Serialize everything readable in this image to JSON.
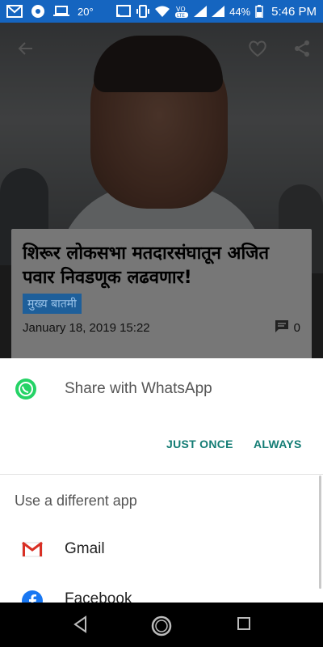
{
  "status_bar": {
    "temperature": "20°",
    "battery": "44%",
    "time": "5:46 PM",
    "network_badge": "VO LTE",
    "background_color": "#1565c0"
  },
  "article": {
    "headline": "शिरूर लोकसभा मतदारसंघातून अजित पवार निवडणूक लढवणार!",
    "category": "मुख्य बातमी",
    "date": "January 18, 2019 15:22",
    "comment_count": "0",
    "top_icons": [
      "back-arrow-icon",
      "heart-icon",
      "share-icon"
    ]
  },
  "share_sheet": {
    "primary_app": "Share with WhatsApp",
    "just_once": "JUST ONCE",
    "always": "ALWAYS",
    "different_app_label": "Use a different app",
    "apps": [
      {
        "name": "Gmail",
        "icon": "gmail-icon"
      },
      {
        "name": "Facebook",
        "icon": "facebook-icon"
      }
    ],
    "accent_color": "#137c74"
  },
  "nav_bar": {
    "buttons": [
      "back-triangle-icon",
      "home-circle-icon",
      "recents-square-icon"
    ]
  }
}
